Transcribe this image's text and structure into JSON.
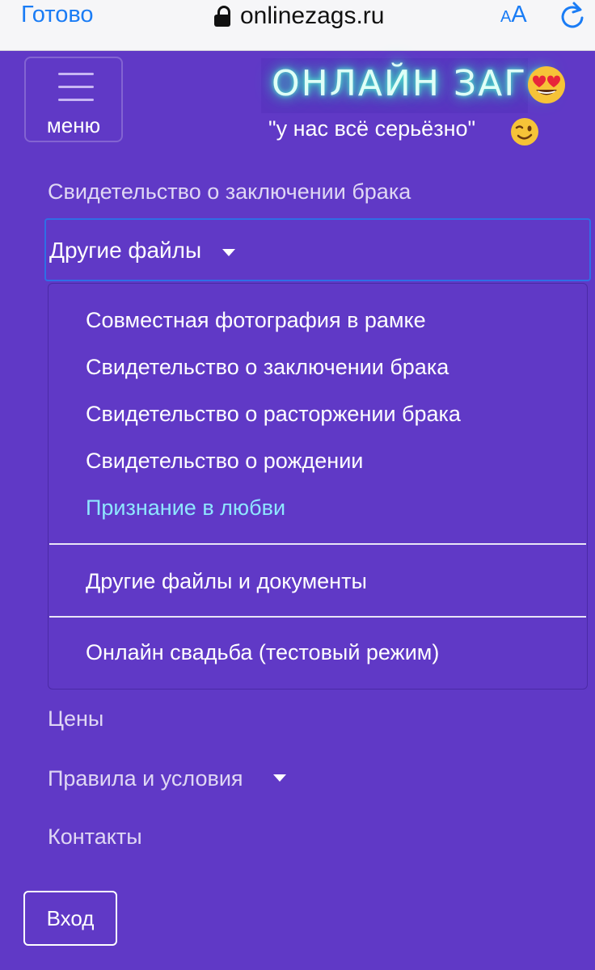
{
  "browser": {
    "done_label": "Готово",
    "url": "onlinezags.ru",
    "text_size_small": "A",
    "text_size_big": "A"
  },
  "header": {
    "menu_label": "меню",
    "brand_title": "ОНЛАЙН ЗАГС",
    "tagline": "\"у нас всё серьёзно\""
  },
  "nav": {
    "marriage_certificate": "Свидетельство о заключении брака",
    "other_files": "Другие файлы",
    "dropdown_items": [
      "Совместная фотография в рамке",
      "Свидетельство о заключении брака",
      "Свидетельство о расторжении брака",
      "Свидетельство о рождении",
      "Признание в любви",
      "Другие файлы и документы",
      "Онлайн свадьба (тестовый режим)"
    ],
    "prices": "Цены",
    "terms": "Правила и условия",
    "contacts": "Контакты"
  },
  "login_label": "Вход",
  "colors": {
    "background": "#6039c6",
    "accent_blue": "#1a7cf5",
    "neon": "#5af2d5",
    "highlight": "#27b7f3"
  }
}
